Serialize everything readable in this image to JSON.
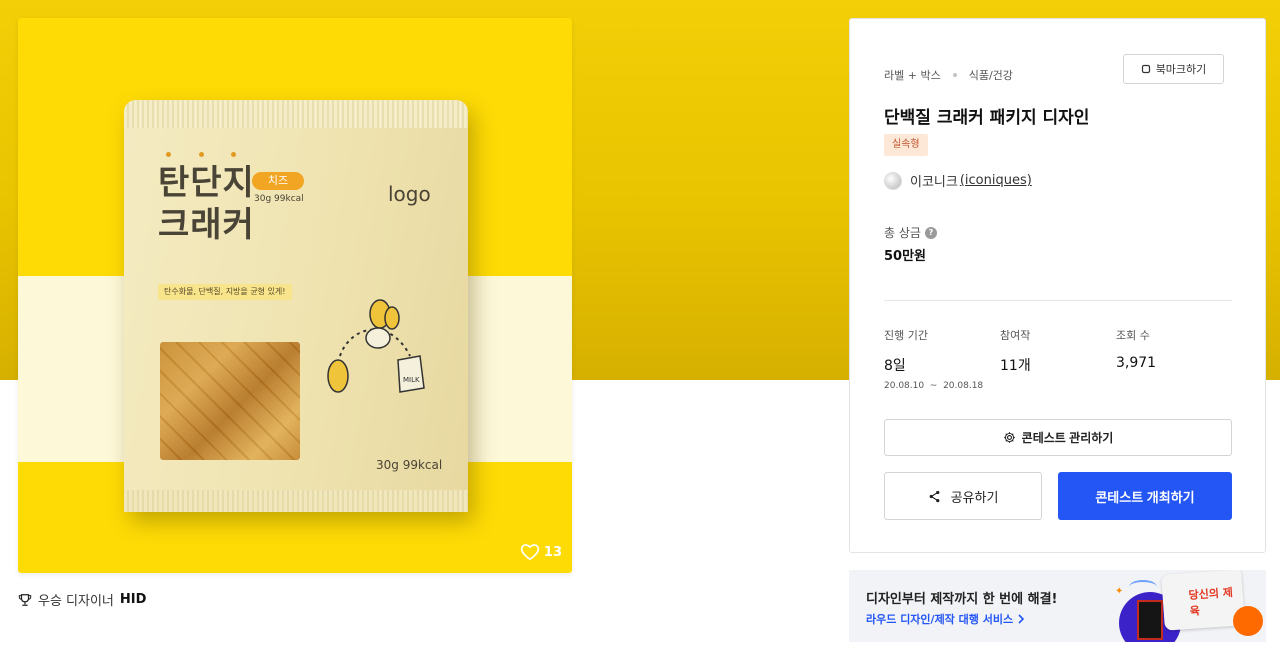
{
  "product_image": {
    "brand_name": "탄단지\n크래커",
    "flavor": "치즈",
    "net_small": "30g 99kcal",
    "logo": "logo",
    "tagline": "탄수화물, 단백질, 지방을 균형 있게!",
    "net_big": "30g 99kcal",
    "like_count": "13"
  },
  "winner": {
    "label": "우승 디자이너",
    "name": "HID"
  },
  "contest": {
    "category": "라벨 + 박스",
    "subcategory": "식품/건강",
    "bookmark_label": "북마크하기",
    "title": "단백질 크래커 패키지 디자인",
    "type_badge": "실속형",
    "host_name": "이코니크",
    "host_handle": "(iconiques)",
    "prize_label": "총 상금",
    "prize_value": "50만원",
    "stats": {
      "period_label": "진행 기간",
      "period_value": "8일",
      "period_dates": "20.08.10  ~  20.08.18",
      "entries_label": "참여작",
      "entries_value": "11개",
      "views_label": "조회 수",
      "views_value": "3,971"
    },
    "manage_label": "콘테스트 관리하기",
    "share_label": "공유하기",
    "host_contest_label": "콘테스트 개최하기"
  },
  "ad": {
    "title": "디자인부터 제작까지 한 번에 해결!",
    "link": "라우드 디자인/제작 대행 서비스",
    "card_text": "당신의 제육"
  },
  "colors": {
    "primary": "#2456f5",
    "hero_yellow": "#f2cf07",
    "badge_bg": "#fde8d8",
    "badge_text": "#c0532a"
  }
}
